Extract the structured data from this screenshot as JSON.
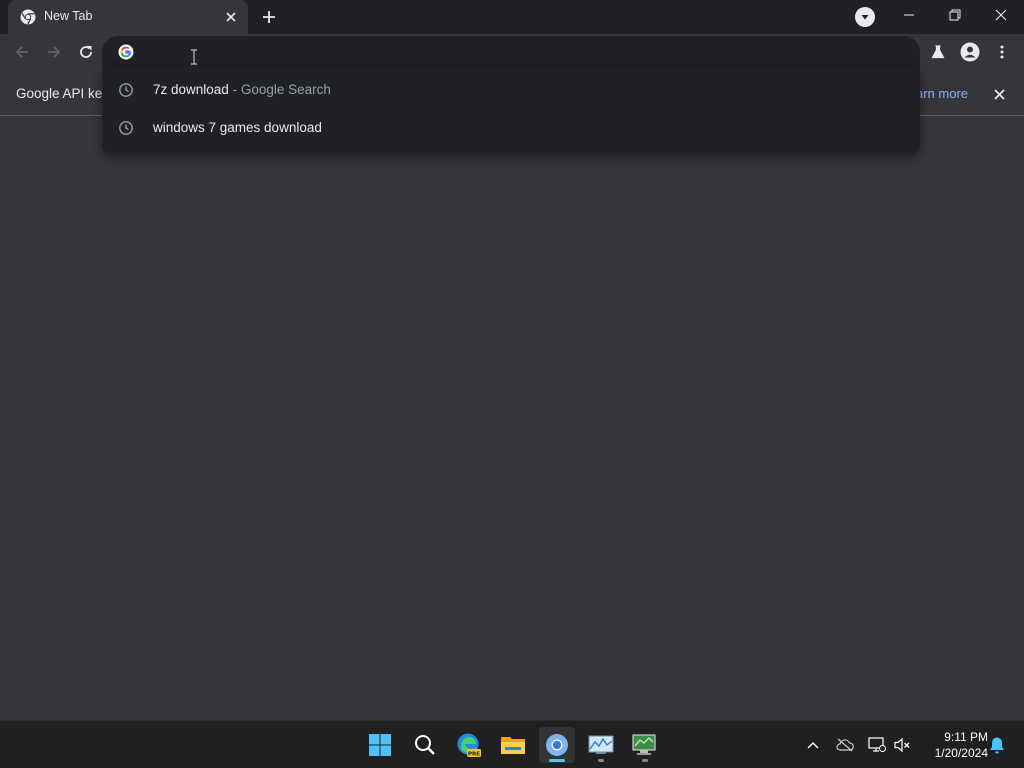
{
  "browser": {
    "tab": {
      "title": "New Tab"
    },
    "omnibox": {
      "value": "",
      "placeholder": ""
    },
    "infobar": {
      "message": "Google API key",
      "link": "arn more"
    },
    "suggestions": [
      {
        "query": "7z download",
        "separator": " - ",
        "source": "Google Search"
      },
      {
        "query": "windows 7 games download",
        "separator": "",
        "source": ""
      }
    ]
  },
  "taskbar": {
    "time": "9:11 PM",
    "date": "1/20/2024",
    "apps": [
      {
        "name": "start",
        "icon": "windows-start-icon"
      },
      {
        "name": "search",
        "icon": "search-icon"
      },
      {
        "name": "edge-preview",
        "icon": "edge-icon",
        "badge": "PRE"
      },
      {
        "name": "file-explorer",
        "icon": "folder-icon"
      },
      {
        "name": "chrome",
        "icon": "chrome-icon",
        "active": true
      },
      {
        "name": "performance-monitor",
        "icon": "chart-icon"
      },
      {
        "name": "task-manager",
        "icon": "monitor-app-icon"
      }
    ]
  },
  "colors": {
    "tabstrip": "#202124",
    "toolbar": "#35363a",
    "link": "#8ab4f8",
    "taskbar": "#202020",
    "active_indicator": "#4cc2ff"
  }
}
